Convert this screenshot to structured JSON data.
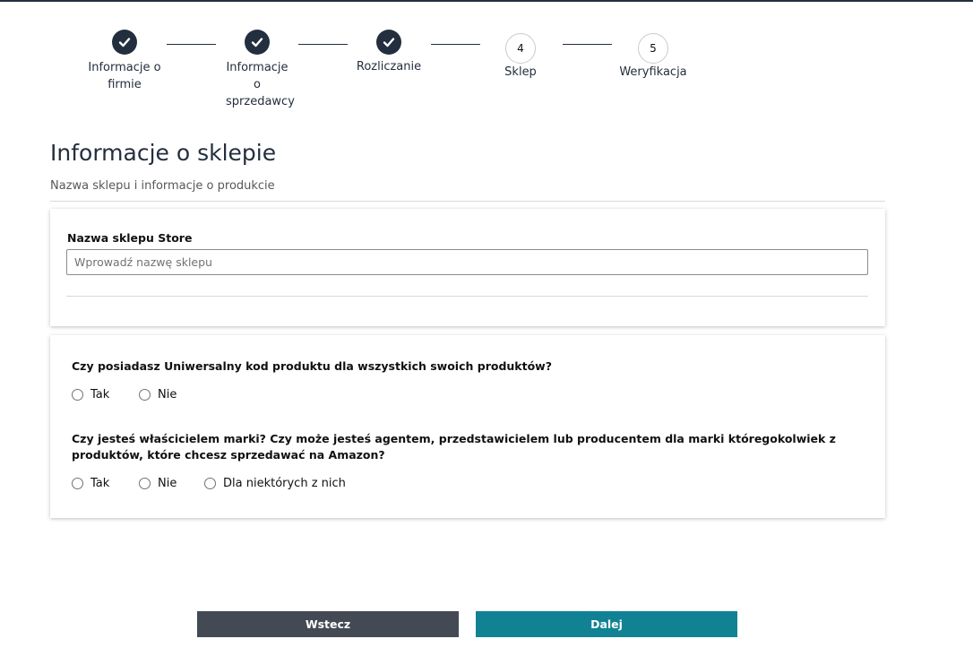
{
  "stepper": {
    "steps": [
      {
        "label": "Informacje o firmie",
        "state": "done",
        "icon": "check-icon"
      },
      {
        "label": "Informacje o sprzedawcy",
        "state": "done",
        "icon": "check-icon"
      },
      {
        "label": "Rozliczanie",
        "state": "done",
        "icon": "check-icon"
      },
      {
        "label": "Sklep",
        "state": "current",
        "number": "4"
      },
      {
        "label": "Weryfikacja",
        "state": "todo",
        "number": "5"
      }
    ]
  },
  "page": {
    "title": "Informacje o sklepie",
    "subtitle": "Nazwa sklepu i informacje o produkcie"
  },
  "store_name": {
    "label": "Nazwa sklepu Store",
    "placeholder": "Wprowadź nazwę sklepu",
    "value": ""
  },
  "questions": {
    "upc": {
      "text": "Czy posiadasz Uniwersalny kod produktu dla wszystkich swoich produktów?",
      "options": [
        "Tak",
        "Nie"
      ]
    },
    "brand": {
      "text": "Czy jesteś właścicielem marki? Czy może jesteś agentem, przedstawicielem lub producentem dla marki któregokolwiek z produktów, które chcesz sprzedawać na Amazon?",
      "options": [
        "Tak",
        "Nie",
        "Dla niektórych z nich"
      ]
    }
  },
  "buttons": {
    "back": "Wstecz",
    "next": "Dalej"
  },
  "colors": {
    "dark": "#232f3e",
    "back_button": "#434a54",
    "next_button": "#118294"
  }
}
